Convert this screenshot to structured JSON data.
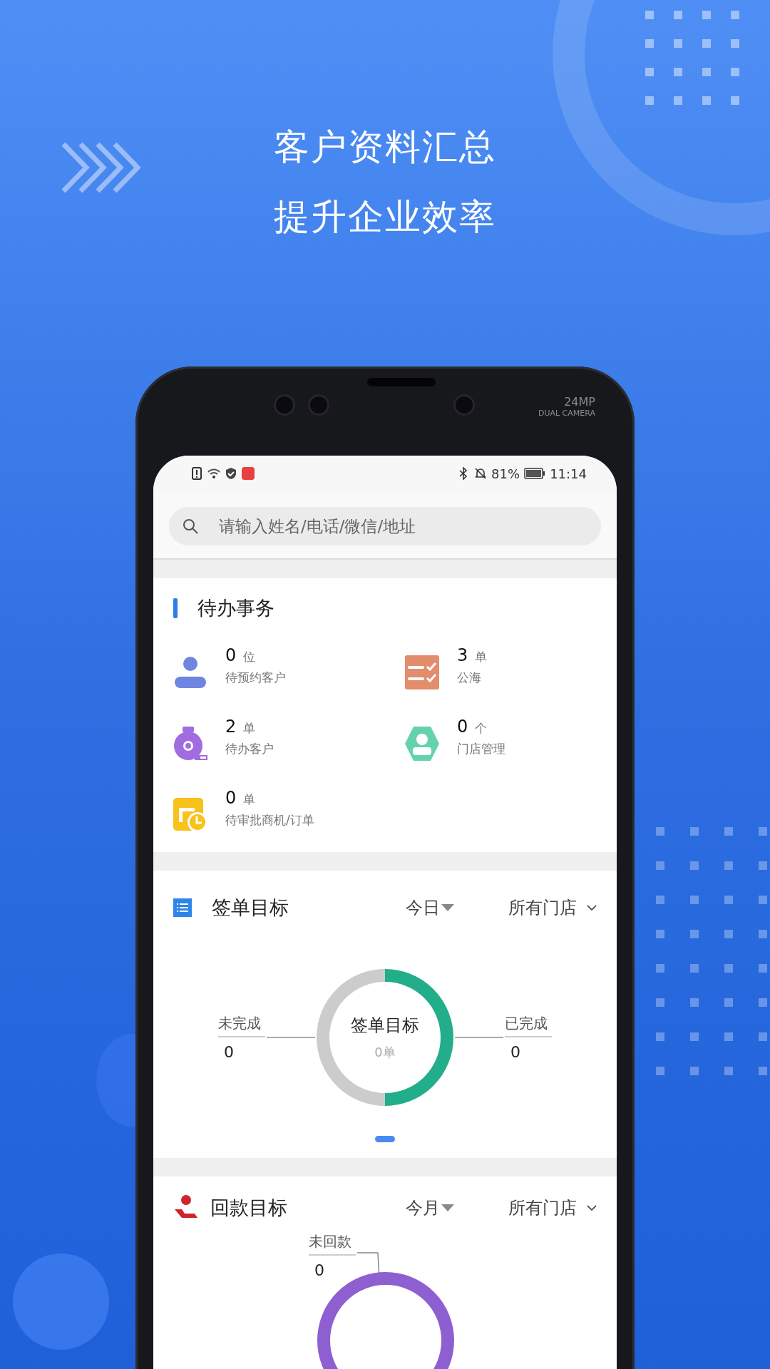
{
  "headline": [
    "客户资料汇总",
    "提升企业效率"
  ],
  "phone": {
    "camera_text": "24MP",
    "camera_subtext": "DUAL CAMERA"
  },
  "status_bar": {
    "battery": "81%",
    "time": "11:14"
  },
  "search": {
    "placeholder": "请输入姓名/电话/微信/地址"
  },
  "todo": {
    "title": "待办事务",
    "items": [
      {
        "kind": "person",
        "count": "0",
        "unit": "位",
        "label": "待预约客户"
      },
      {
        "kind": "checklist",
        "count": "3",
        "unit": "单",
        "label": "公海"
      },
      {
        "kind": "tape",
        "count": "2",
        "unit": "单",
        "label": "待办客户"
      },
      {
        "kind": "badge",
        "count": "0",
        "unit": "个",
        "label": "门店管理"
      },
      {
        "kind": "clock",
        "count": "0",
        "unit": "单",
        "label": "待审批商机/订单"
      }
    ]
  },
  "sign_target": {
    "title": "签单目标",
    "period": "今日",
    "store": "所有门店",
    "left_label": "未完成",
    "left_value": "0",
    "right_label": "已完成",
    "right_value": "0",
    "center_title": "签单目标",
    "center_value": "0单"
  },
  "payment_target": {
    "title": "回款目标",
    "period": "今月",
    "store": "所有门店",
    "label": "未回款",
    "value": "0"
  }
}
